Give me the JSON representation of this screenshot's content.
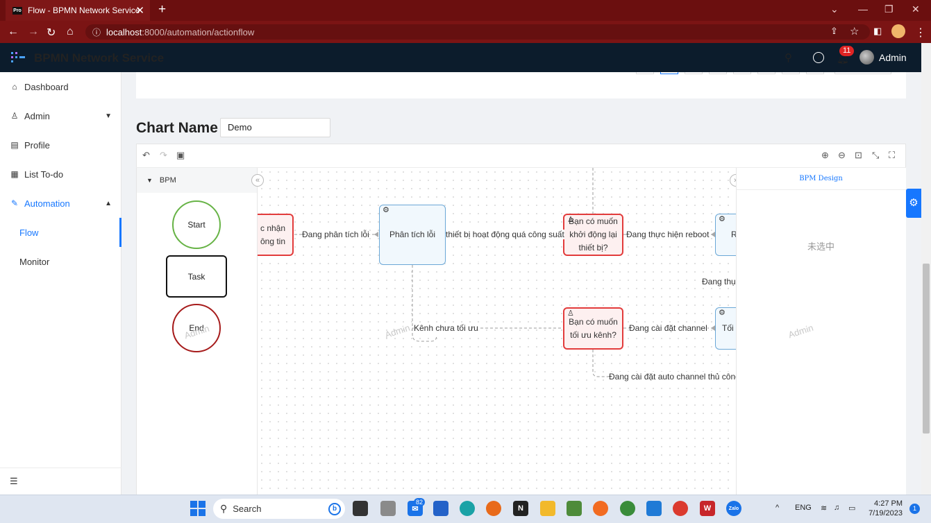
{
  "browser": {
    "tab_title": "Flow - BPMN Network Service",
    "tab_favicon": "Pro",
    "url_host": "localhost",
    "url_path": ":8000/automation/actionflow"
  },
  "app": {
    "title": "BPMN Network Service",
    "notification_count": "11",
    "user_name": "Admin"
  },
  "sidebar": {
    "items": [
      {
        "label": "Dashboard",
        "icon": "home-icon"
      },
      {
        "label": "Admin",
        "icon": "user-icon"
      },
      {
        "label": "Profile",
        "icon": "profile-icon"
      },
      {
        "label": "List To-do",
        "icon": "table-icon"
      },
      {
        "label": "Automation",
        "icon": "automation-icon"
      },
      {
        "label": "Flow"
      },
      {
        "label": "Monitor"
      }
    ],
    "active_item": "Flow"
  },
  "chart": {
    "name_label": "Chart Name",
    "name_value": "Demo"
  },
  "palette": {
    "group_label": "BPM",
    "shapes": [
      "Start",
      "Task",
      "End"
    ]
  },
  "canvas": {
    "nodes": {
      "n1_line1": "c nhận",
      "n1_line2": "ông tin",
      "n2": "Phân tích lỗi",
      "n3_line1": "Bạn có muốn",
      "n3_line2": "khởi động lại",
      "n3_line3": "thiết bị?",
      "n4": "R",
      "n5_line1": "Bạn có muốn",
      "n5_line2": "tối ưu kênh?",
      "n6": "Tối"
    },
    "edges": {
      "e1": "Đang phân tích lỗi",
      "e2": "thiết bị hoạt động quá công suất",
      "e3": "Đang thực hiện reboot",
      "e4": "Đang thụ",
      "e5": "Kênh chưa tối ưu",
      "e6": "Đang cài đặt channel",
      "e7": "Đang cài đặt auto channel thủ công"
    },
    "watermark": "Admin"
  },
  "right_panel": {
    "tab": "BPM Design",
    "empty_text": "未选中"
  },
  "taskbar": {
    "search_placeholder": "Search",
    "mail_badge": "82",
    "lang": "ENG",
    "time": "4:27 PM",
    "date": "7/19/2023",
    "notification_count": "1"
  },
  "colors": {
    "browser_frame": "#7b1414",
    "app_header": "#0c1c2c",
    "accent": "#1677ff",
    "user_task_border": "#e23b3b",
    "service_task_border": "#6aa7d6",
    "start_border": "#67b346",
    "end_border": "#a61b1b"
  }
}
